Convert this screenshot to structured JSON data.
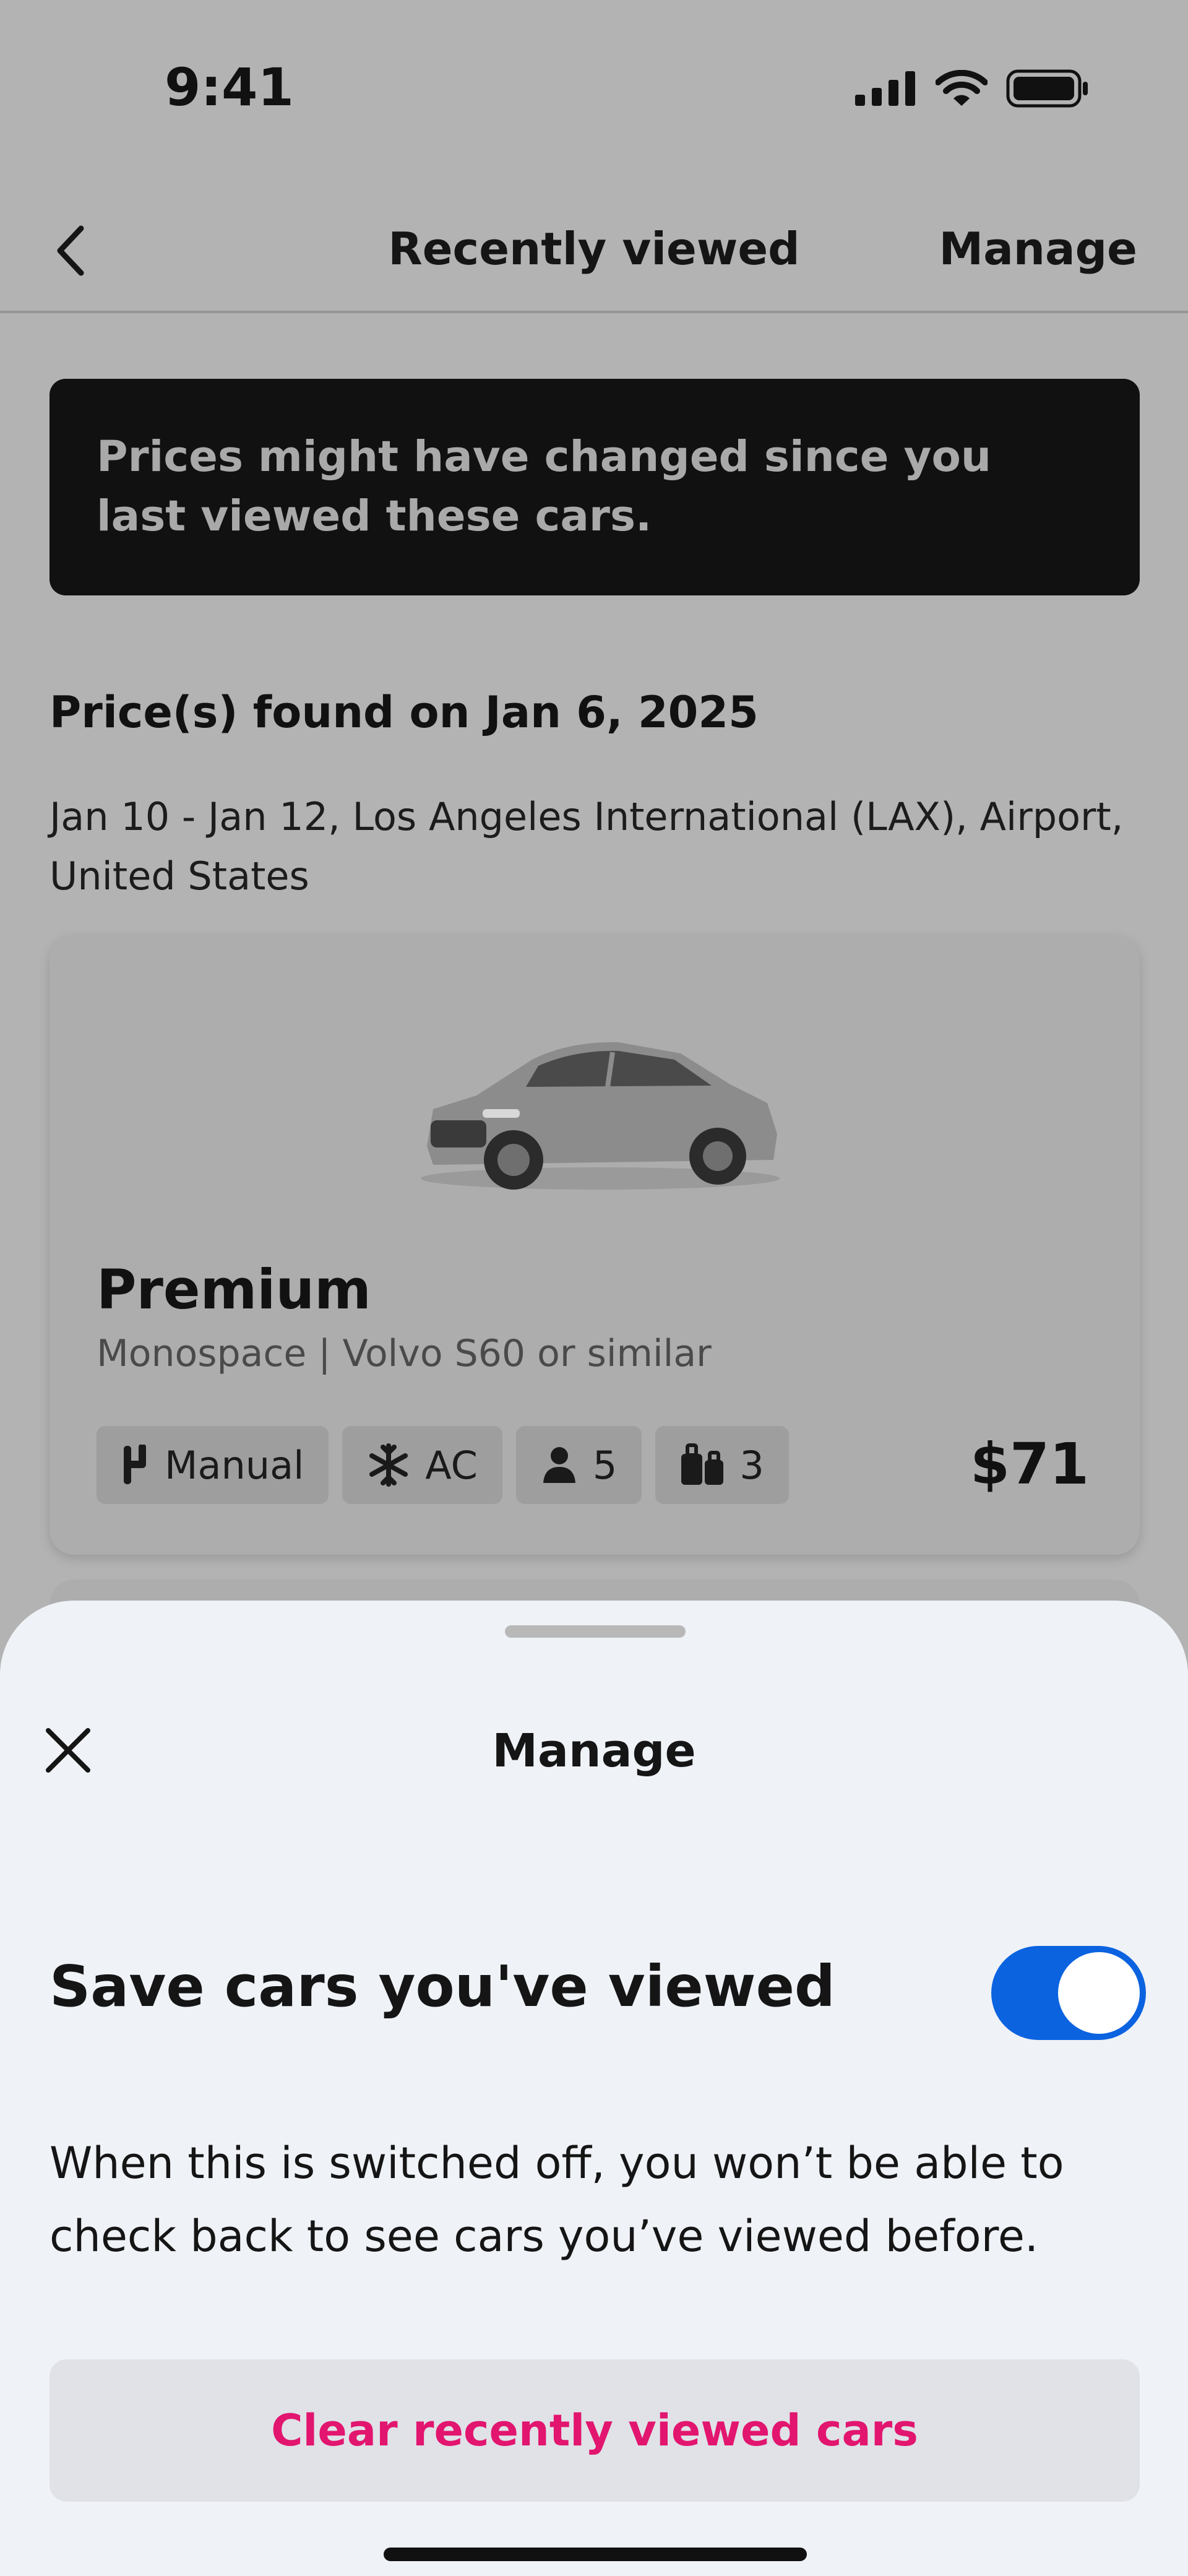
{
  "status_bar": {
    "time": "9:41"
  },
  "header": {
    "title": "Recently viewed",
    "manage_label": "Manage"
  },
  "banner": {
    "text": "Prices might have changed since you last viewed these cars."
  },
  "search": {
    "price_found": "Price(s) found on Jan 6, 2025",
    "trip_details": "Jan 10 - Jan 12, Los Angeles International (LAX), Airport, United States"
  },
  "car": {
    "category": "Premium",
    "model": "Monospace | Volvo S60 or similar",
    "features": [
      {
        "icon": "gearshift-icon",
        "label": "Manual"
      },
      {
        "icon": "snowflake-icon",
        "label": "AC"
      },
      {
        "icon": "person-icon",
        "label": "5"
      },
      {
        "icon": "luggage-icon",
        "label": "3"
      }
    ],
    "price": "$71"
  },
  "sheet": {
    "title": "Manage",
    "setting_label": "Save cars you've viewed",
    "toggle_on": true,
    "description": "When this is switched off, you won’t be able to check back to see cars you’ve viewed before.",
    "clear_button_label": "Clear recently viewed cars"
  },
  "colors": {
    "accent_blue": "#0b63e0",
    "clear_pink": "#e2156f",
    "sheet_background": "#eff2f7",
    "overlay_background": "#b3b3b3"
  }
}
